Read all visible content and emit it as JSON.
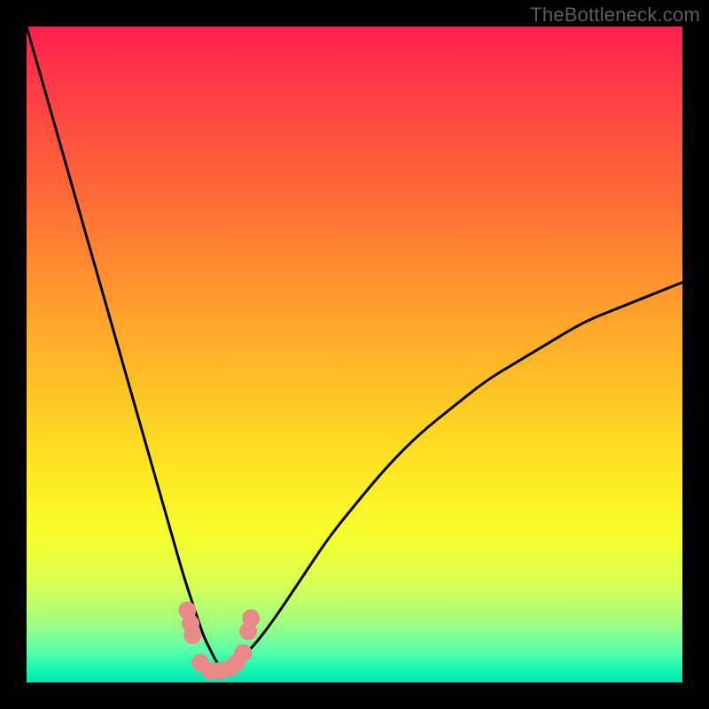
{
  "watermark": "TheBottleneck.com",
  "colors": {
    "frame": "#000000",
    "gradient_top": "#ff1f4f",
    "gradient_bottom": "#00e6b0",
    "curve": "#000000",
    "marker": "#e98a88"
  },
  "chart_data": {
    "type": "line",
    "title": "",
    "xlabel": "",
    "ylabel": "",
    "xlim": [
      0,
      100
    ],
    "ylim": [
      0,
      100
    ],
    "series": [
      {
        "name": "bottleneck-curve",
        "x": [
          0,
          2,
          4,
          6,
          8,
          10,
          12,
          14,
          16,
          18,
          20,
          22,
          24,
          26,
          27,
          28,
          29,
          30,
          31,
          32,
          33,
          35,
          38,
          42,
          46,
          50,
          55,
          60,
          65,
          70,
          75,
          80,
          85,
          90,
          95,
          100
        ],
        "y": [
          100,
          93,
          86,
          79,
          72,
          65,
          58,
          51,
          44,
          37,
          30,
          23,
          16,
          10,
          7,
          5,
          3,
          2,
          2,
          3,
          4,
          6,
          10,
          16,
          22,
          27,
          33,
          38,
          42,
          46,
          49,
          52,
          55,
          57,
          59,
          61
        ]
      }
    ],
    "markers": {
      "name": "highlight-points",
      "x": [
        24.5,
        25.0,
        25.3,
        26.5,
        28.0,
        29.5,
        31.0,
        32.0,
        33.0,
        33.8,
        34.2
      ],
      "y": [
        11.0,
        9.0,
        7.2,
        3.0,
        1.8,
        1.8,
        2.2,
        3.0,
        4.5,
        7.8,
        9.8
      ]
    }
  }
}
